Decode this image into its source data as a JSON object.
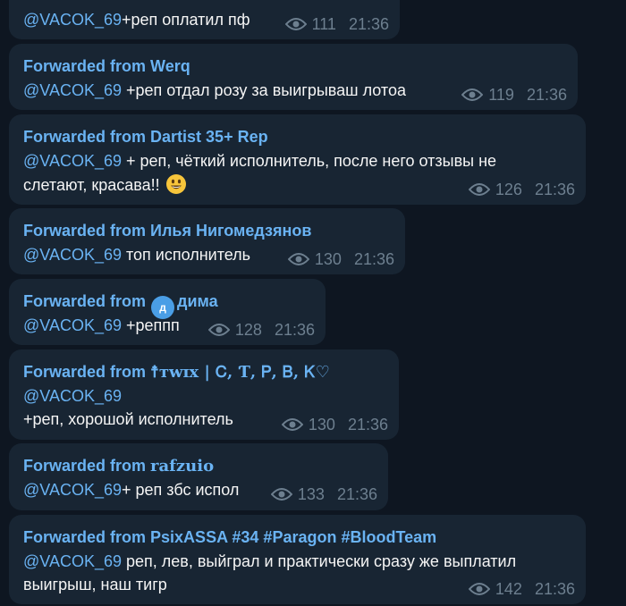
{
  "messages": [
    {
      "mention": "@VACOK_69",
      "text": "+реп оплатил пф",
      "views": "111",
      "time": "21:36"
    },
    {
      "forward_prefix": "Forwarded from",
      "author": "Werq",
      "mention": "@VACOK_69",
      "text": " +реп отдал розу за выигрываш лотоа",
      "views": "119",
      "time": "21:36"
    },
    {
      "forward_prefix": "Forwarded from",
      "author": "Dartist 35+ Rep",
      "mention": "@VACOK_69",
      "text": " + реп, чёткий исполнитель, после него отзывы не",
      "text2": "слетают, красава!!",
      "emoji": "smiling-face-emoji",
      "views": "126",
      "time": "21:36"
    },
    {
      "forward_prefix": "Forwarded from",
      "author": "Илья Нигомедзянов",
      "mention": "@VACOK_69",
      "text": " топ исполнитель",
      "views": "130",
      "time": "21:36"
    },
    {
      "forward_prefix": "Forwarded from",
      "avatar_letter": "д",
      "author": "дима",
      "mention": "@VACOK_69",
      "text": " +реппп",
      "views": "128",
      "time": "21:36"
    },
    {
      "forward_prefix": "Forwarded from",
      "author": "☨ᴛᴡɪx | Ꮯ, Ƭ, Ꮲ, Ᏼ, Ꮶ♡",
      "mention": "@VACOK_69",
      "text": "+реп, хорошой исполнитель",
      "views": "130",
      "time": "21:36"
    },
    {
      "forward_prefix": "Forwarded from",
      "author": "𝐫𝐚𝐟𝐳𝐮𝐢𝐨",
      "mention": "@VACOK_69",
      "text": "+ реп збс испол",
      "views": "133",
      "time": "21:36"
    },
    {
      "forward_prefix": "Forwarded from",
      "author": "PsixASSA #34 #Paragon #BloodTeam",
      "mention": "@VACOK_69",
      "text": " реп, лев, выйграл и практически сразу же выплатил",
      "text2": "выигрыш, наш тигр",
      "views": "142",
      "time": "21:36"
    }
  ],
  "colors": {
    "background": "#0e1621",
    "bubble": "#182533",
    "accent": "#6ab3f3",
    "meta": "#6d7f8f"
  },
  "icons": {
    "views": "eye-icon"
  }
}
